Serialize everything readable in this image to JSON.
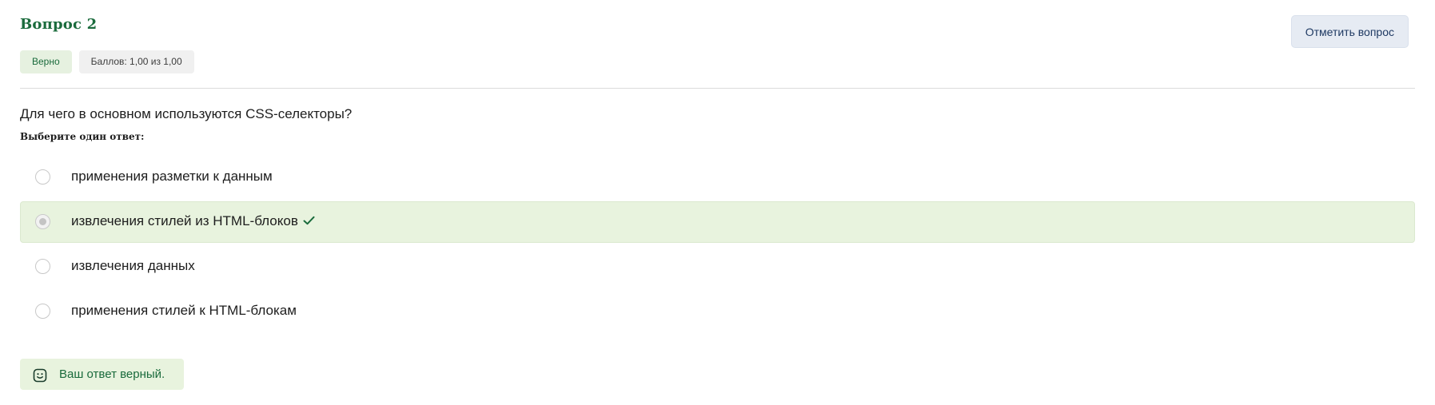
{
  "question": {
    "title": "Вопрос 2",
    "status": "Верно",
    "score": "Баллов: 1,00 из 1,00",
    "flag_label": "Отметить вопрос",
    "text": "Для чего в основном используются CSS-селекторы?",
    "prompt": "Выберите один ответ:"
  },
  "answers": [
    {
      "label": "применения разметки к данным",
      "selected": false,
      "correct": false
    },
    {
      "label": "извлечения стилей из HTML-блоков",
      "selected": true,
      "correct": true
    },
    {
      "label": "извлечения данных",
      "selected": false,
      "correct": false
    },
    {
      "label": "применения стилей к HTML-блокам",
      "selected": false,
      "correct": false
    }
  ],
  "feedback": {
    "text": "Ваш ответ верный.",
    "icon": "smiley-icon"
  },
  "icons": {
    "correct_mark": "check-icon"
  },
  "colors": {
    "accent_green": "#1a6b3c",
    "correct_background": "#e8f3de",
    "flag_button_background": "#e6ebf3",
    "flag_button_text": "#1f3a63"
  }
}
